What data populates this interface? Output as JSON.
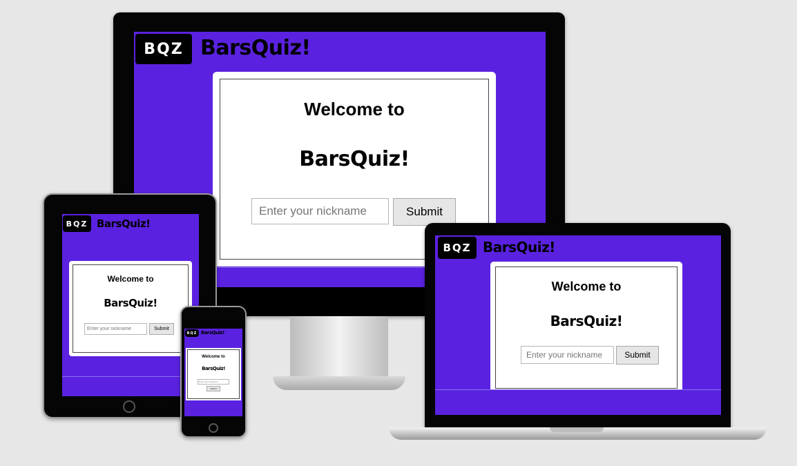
{
  "brand": {
    "logo_mark": "BQZ",
    "name": "BarsQuiz!",
    "primary_color": "#5a22e0",
    "background_color": "#e7e7e7"
  },
  "welcome": {
    "heading": "Welcome to",
    "brand_line": "BarsQuiz!"
  },
  "form": {
    "nickname_placeholder": "Enter your nickname",
    "submit_label": "Submit"
  },
  "devices": [
    "desktop-monitor",
    "tablet",
    "laptop",
    "phone"
  ]
}
